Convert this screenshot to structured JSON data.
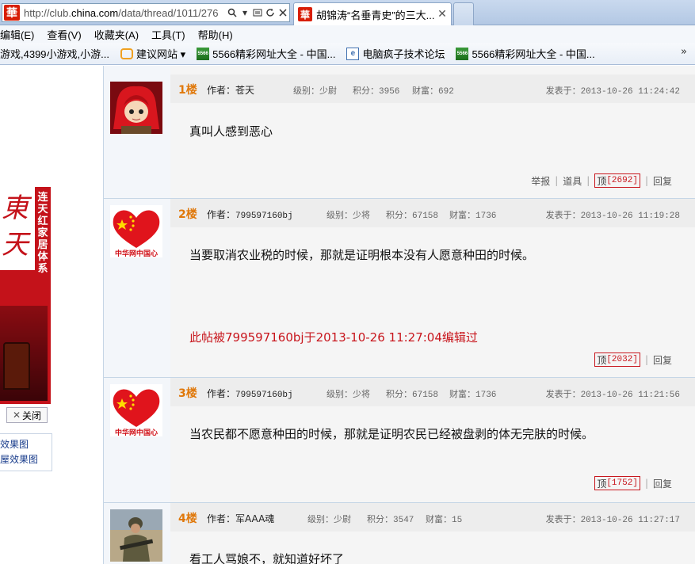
{
  "browser": {
    "url_prefix": "http://club.",
    "url_domain": "china.com",
    "url_path": "/data/thread/1011/276",
    "tab_title": "胡锦涛“名垂青史”的三大...",
    "site_icon_char": "華"
  },
  "menu": [
    "编辑(E)",
    "查看(V)",
    "收藏夹(A)",
    "工具(T)",
    "帮助(H)"
  ],
  "favorites": [
    {
      "label": "游戏,4399小游戏,小游...",
      "icon": "none"
    },
    {
      "label": "建议网站 ▾",
      "icon": "suggest-icon"
    },
    {
      "label": "5566精彩网址大全 - 中国...",
      "icon": "5566-icon"
    },
    {
      "label": "电脑疯子技术论坛",
      "icon": "pc-icon"
    },
    {
      "label": "5566精彩网址大全 - 中国...",
      "icon": "5566-icon"
    }
  ],
  "favorites_more": "»",
  "sidebar": {
    "ad_text": "连天红家居体系",
    "close_label": "关闭",
    "links": [
      "效果图",
      "屋效果图"
    ]
  },
  "posts": [
    {
      "floor": "1楼",
      "author_label": "作者：",
      "author": "苍天",
      "rank": "级别：少尉",
      "points": "积分：3956",
      "wealth": "财富：692",
      "posted": "发表于：2013-10-26 11:24:42",
      "body": "真叫人感到恶心",
      "edit_note": "",
      "report": "举报",
      "tools": "道具",
      "ding_label": "顶",
      "ding_count": "[2692]",
      "reply": "回复"
    },
    {
      "floor": "2楼",
      "author_label": "作者：",
      "author": "799597160bj",
      "rank": "级别：少将",
      "points": "积分：67158",
      "wealth": "财富：1736",
      "posted": "发表于：2013-10-26 11:19:28",
      "body": "当要取消农业税的时候，那就是证明根本没有人愿意种田的时候。",
      "edit_note": "此帖被799597160bj于2013-10-26 11:27:04编辑过",
      "ding_label": "顶",
      "ding_count": "[2032]",
      "reply": "回复"
    },
    {
      "floor": "3楼",
      "author_label": "作者：",
      "author": "799597160bj",
      "rank": "级别：少将",
      "points": "积分：67158",
      "wealth": "财富：1736",
      "posted": "发表于：2013-10-26 11:21:56",
      "body": "当农民都不愿意种田的时候，那就是证明农民已经被盘剥的体无完肤的时候。",
      "edit_note": "",
      "ding_label": "顶",
      "ding_count": "[1752]",
      "reply": "回复"
    },
    {
      "floor": "4楼",
      "author_label": "作者：",
      "author": "军AAA魂",
      "rank": "级别：少尉",
      "points": "积分：3547",
      "wealth": "财富：15",
      "posted": "发表于：2013-10-26 11:27:17",
      "body": "看工人骂娘不，就知道好坏了"
    }
  ],
  "avatar_badge": "中华网中国心",
  "colors": {
    "floor": "#e0780a",
    "edit_note": "#c8161d",
    "ding_border": "#c8161d",
    "header_bg": "#ededed"
  }
}
